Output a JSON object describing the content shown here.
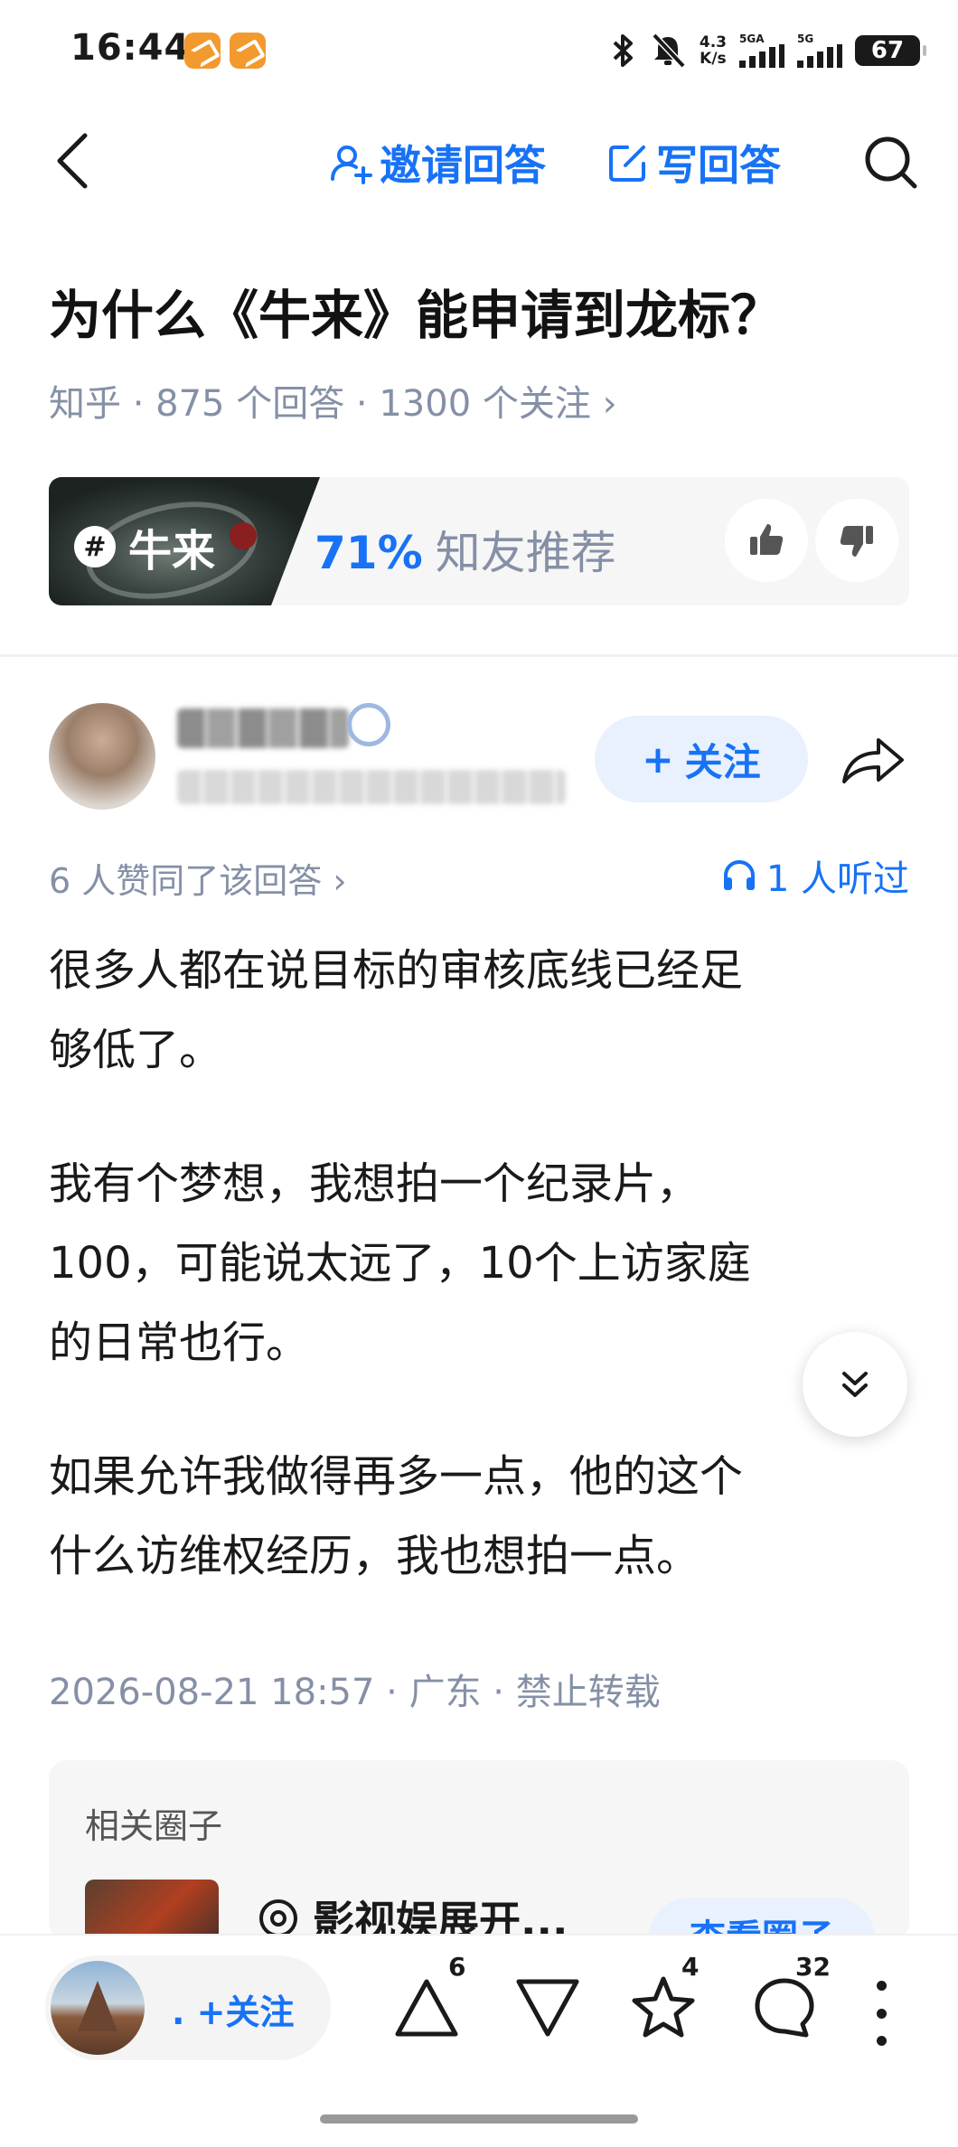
{
  "status_bar": {
    "time": "16:44",
    "net_speed_value": "4.3",
    "net_speed_unit": "K/s",
    "sim1_label": "5GA",
    "sim2_label": "5G",
    "battery": "67",
    "icons": [
      "bluetooth-icon",
      "mute-icon"
    ]
  },
  "nav": {
    "invite_label": "邀请回答",
    "write_label": "写回答"
  },
  "question": {
    "title": "为什么《牛来》能申请到龙标？",
    "meta": "知乎 · 875 个回答 · 1300 个关注 ›"
  },
  "topic": {
    "name": "牛来",
    "hash": "#",
    "recommend_pct": "71%",
    "recommend_text": "知友推荐"
  },
  "answer": {
    "follow_label": "关注",
    "follow_plus": "+",
    "votes_text": "6 人赞同了该回答 ›",
    "listen_text": "1 人听过",
    "paragraphs": [
      "很多人都在说目标的审核底线已经足\n够低了。",
      "我有个梦想，我想拍一个纪录片，\n100，可能说太远了，10个上访家庭\n的日常也行。",
      "如果允许我做得再多一点，他的这个\n什么访维权经历，我也想拍一点。"
    ],
    "meta": "2026-08-21 18:57 · 广东 · 禁止转载"
  },
  "related": {
    "title": "相关圈子",
    "circle_name": "影视娱展开...",
    "cta_label": "查看圈子"
  },
  "bottom_bar": {
    "follow_dot": ".",
    "follow_label": "+关注",
    "upvote_count": "6",
    "star_count": "4",
    "comment_count": "32"
  },
  "colors": {
    "accent": "#1772f6",
    "muted_text": "#8590a6",
    "card_bg": "#f6f6f6"
  }
}
